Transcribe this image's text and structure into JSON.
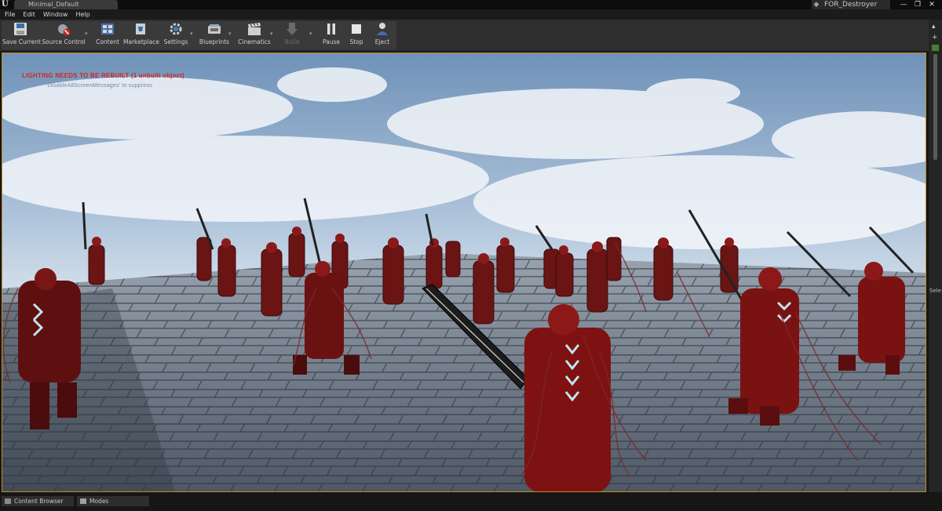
{
  "window": {
    "logo": "U",
    "tab_title": "Minimal_Default",
    "project_name": "FOR_Destroyer",
    "controls": [
      "—",
      "❐",
      "✕"
    ]
  },
  "menu": [
    "File",
    "Edit",
    "Window",
    "Help"
  ],
  "toolbar": {
    "save_current": "Save Current",
    "source_control": "Source Control",
    "content": "Content",
    "marketplace": "Marketplace",
    "settings": "Settings",
    "blueprints": "Blueprints",
    "cinematics": "Cinematics",
    "build": "Build",
    "pause": "Pause",
    "stop": "Stop",
    "eject": "Eject"
  },
  "viewport": {
    "lighting_warning": "LIGHTING NEEDS TO BE REBUILT (1 unbuilt object)",
    "suppress_hint": "'DisableAllScreenMessages' to suppress"
  },
  "side_panel": {
    "label": "Sele"
  },
  "bottom_tabs": {
    "content_browser": "Content Browser",
    "modes": "Modes"
  },
  "colors": {
    "viewport_border": "#c48b1f",
    "warning_text": "#d22626",
    "armor_red": "#7e1212"
  }
}
